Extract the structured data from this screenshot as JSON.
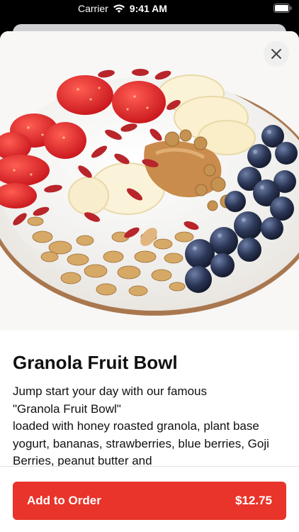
{
  "status_bar": {
    "carrier": "Carrier",
    "time": "9:41 AM"
  },
  "product": {
    "image_icon": "granola-fruit-bowl-photo",
    "title": "Granola Fruit Bowl",
    "description": "Jump start your day with our famous\n\"Granola Fruit Bowl\"\nloaded with honey roasted granola, plant base yogurt, bananas, strawberries, blue berries, Goji Berries, peanut butter and"
  },
  "actions": {
    "close_icon": "close-icon",
    "add_label": "Add to Order",
    "price": "$12.75"
  },
  "colors": {
    "accent": "#e8342a",
    "background": "#ffffff"
  }
}
